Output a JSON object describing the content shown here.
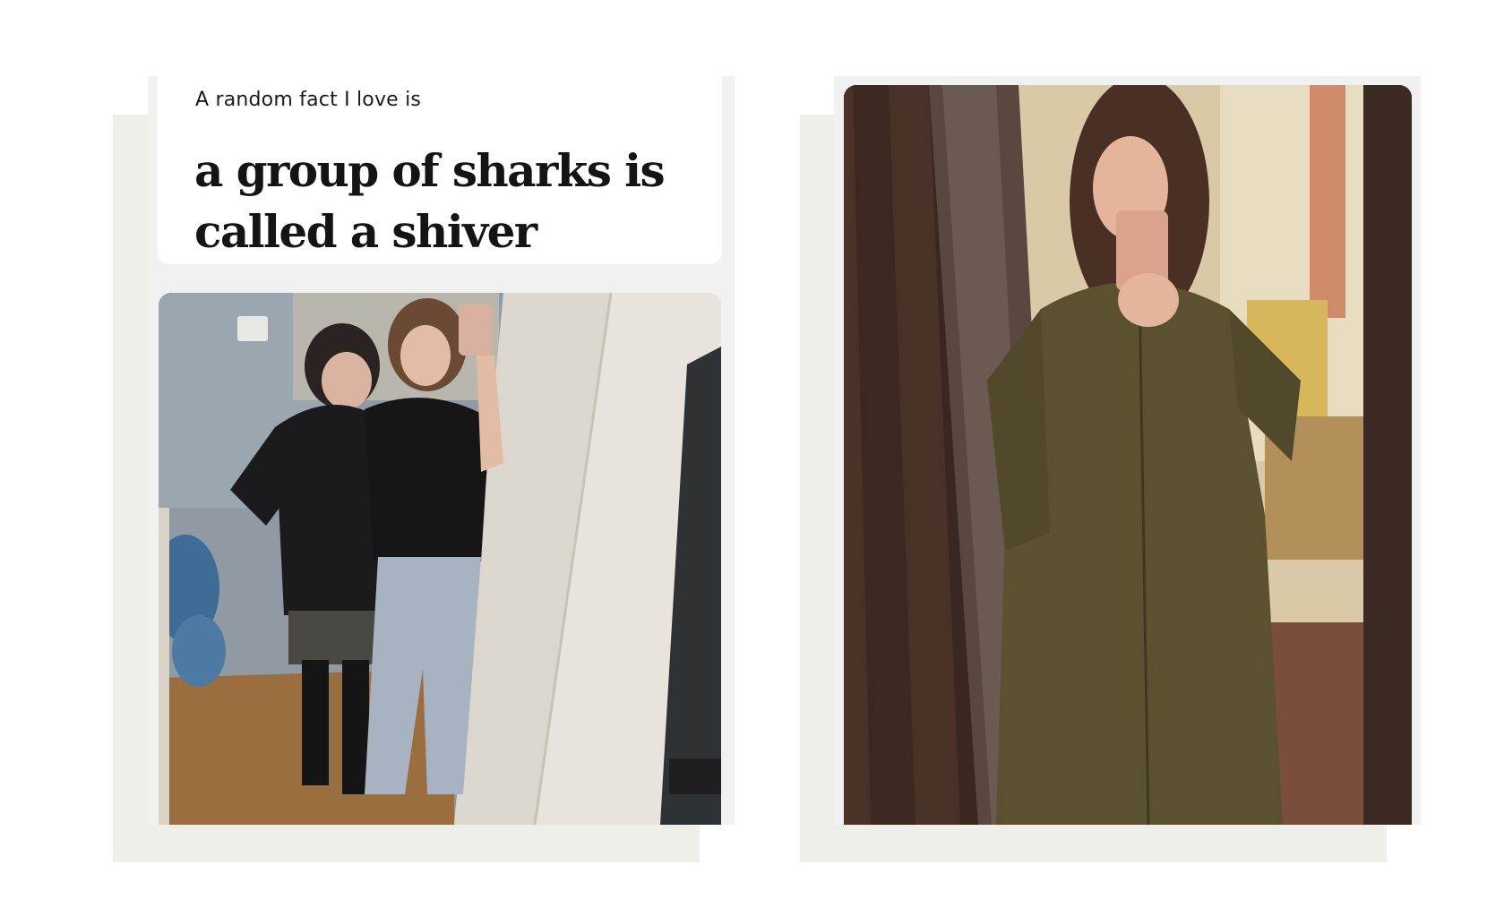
{
  "prompt_card": {
    "label": "A random fact I love is",
    "answer": "a group of sharks is called a shiver"
  },
  "photos": [
    {
      "name": "mirror-selfie-two-people",
      "description_icon": "photo-icon"
    },
    {
      "name": "mirror-selfie-olive-coat",
      "description_icon": "photo-icon"
    }
  ],
  "colors": {
    "backdrop": "#efefe9",
    "panel": "#f1f1f1",
    "card": "#ffffff",
    "text": "#141414"
  }
}
